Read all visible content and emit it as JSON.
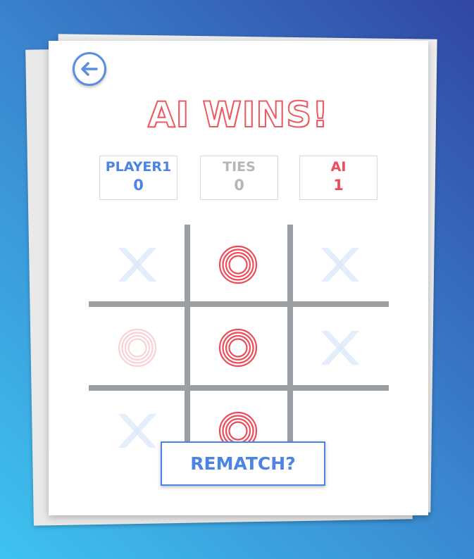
{
  "header": {
    "title": "AI WINS!",
    "back_icon": "arrow-left-circle-icon"
  },
  "scores": [
    {
      "label": "PLAYER1",
      "value": "0",
      "color": "#4b84e5"
    },
    {
      "label": "TIES",
      "value": "0",
      "color": "#b6b6b6"
    },
    {
      "label": "AI",
      "value": "1",
      "color": "#ee4b5a"
    }
  ],
  "board": {
    "cells": [
      "X",
      "O",
      "X",
      "O",
      "O",
      "X",
      "X",
      "O",
      ""
    ],
    "winning_cells": [
      1,
      4,
      7
    ],
    "x_color": "#9ec3f0",
    "o_color": "#ee4b5a",
    "grid_color": "#9b9ea2"
  },
  "actions": {
    "rematch_label": "REMATCH?"
  },
  "colors": {
    "accent_blue": "#4b84e5",
    "accent_red": "#ee4b5a"
  }
}
